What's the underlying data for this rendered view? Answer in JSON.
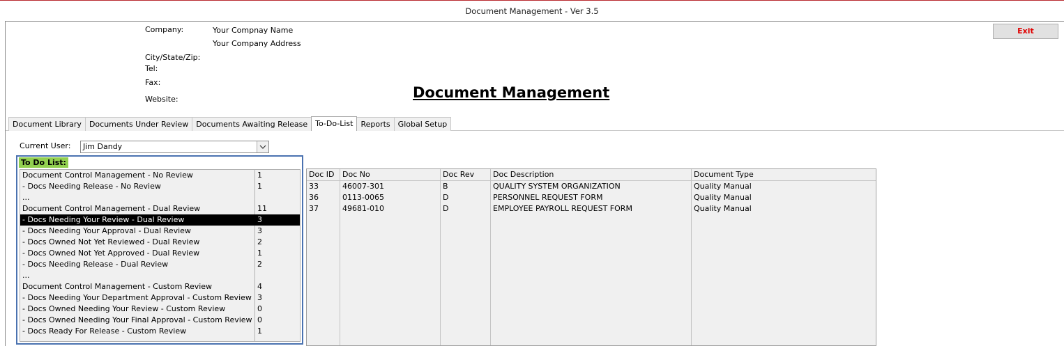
{
  "window": {
    "title": "Document Management - Ver 3.5"
  },
  "company": {
    "company_label": "Company:",
    "company_name": "Your Compnay Name",
    "company_address": "Your Company Address",
    "city_label": "City/State/Zip:",
    "tel_label": "Tel:",
    "fax_label": "Fax:",
    "website_label": "Website:"
  },
  "exit_label": "Exit",
  "page_title": "Document Management",
  "tabs": [
    {
      "label": "Document Library"
    },
    {
      "label": "Documents Under Review"
    },
    {
      "label": "Documents Awaiting Release"
    },
    {
      "label": "To-Do-List",
      "active": true
    },
    {
      "label": "Reports"
    },
    {
      "label": "Global Setup"
    }
  ],
  "current_user": {
    "label": "Current User:",
    "value": "Jim Dandy"
  },
  "todo": {
    "header": "To Do List:",
    "items": [
      {
        "label": "Document Control Management - No Review",
        "count": "1"
      },
      {
        "label": " - Docs Needing Release - No Review",
        "count": "1"
      },
      {
        "label": "...",
        "count": ""
      },
      {
        "label": "Document Control Management - Dual Review",
        "count": "11"
      },
      {
        "label": " - Docs Needing Your Review - Dual Review",
        "count": "3",
        "selected": true
      },
      {
        "label": " - Docs Needing Your Approval - Dual Review",
        "count": "3"
      },
      {
        "label": " - Docs Owned Not Yet Reviewed - Dual Review",
        "count": "2"
      },
      {
        "label": " - Docs Owned Not Yet Approved - Dual Review",
        "count": "1"
      },
      {
        "label": " - Docs Needing Release - Dual Review",
        "count": "2"
      },
      {
        "label": "...",
        "count": ""
      },
      {
        "label": "Document Control Management - Custom Review",
        "count": "4"
      },
      {
        "label": " - Docs Needing Your Department Approval - Custom Review",
        "count": "3"
      },
      {
        "label": " - Docs Owned Needing Your Review - Custom Review",
        "count": "0"
      },
      {
        "label": " - Docs Owned Needing Your Final Approval - Custom Review",
        "count": "0"
      },
      {
        "label": " - Docs Ready For Release - Custom Review",
        "count": "1"
      }
    ]
  },
  "grid": {
    "columns": [
      "Doc ID",
      "Doc No",
      "Doc Rev",
      "Doc Description",
      "Document Type"
    ],
    "rows": [
      [
        "33",
        "46007-301",
        "B",
        "QUALITY SYSTEM ORGANIZATION",
        "Quality Manual"
      ],
      [
        "36",
        "0113-0065",
        "D",
        "PERSONNEL REQUEST FORM",
        "Quality Manual"
      ],
      [
        "37",
        "49681-010",
        "D",
        "EMPLOYEE PAYROLL REQUEST FORM",
        "Quality Manual"
      ]
    ]
  },
  "icons": {
    "dropdown": "chevron-down-icon"
  },
  "colors": {
    "exit_text": "#e00000",
    "todo_header_bg": "#92d050",
    "todo_border": "#4a72b0"
  }
}
